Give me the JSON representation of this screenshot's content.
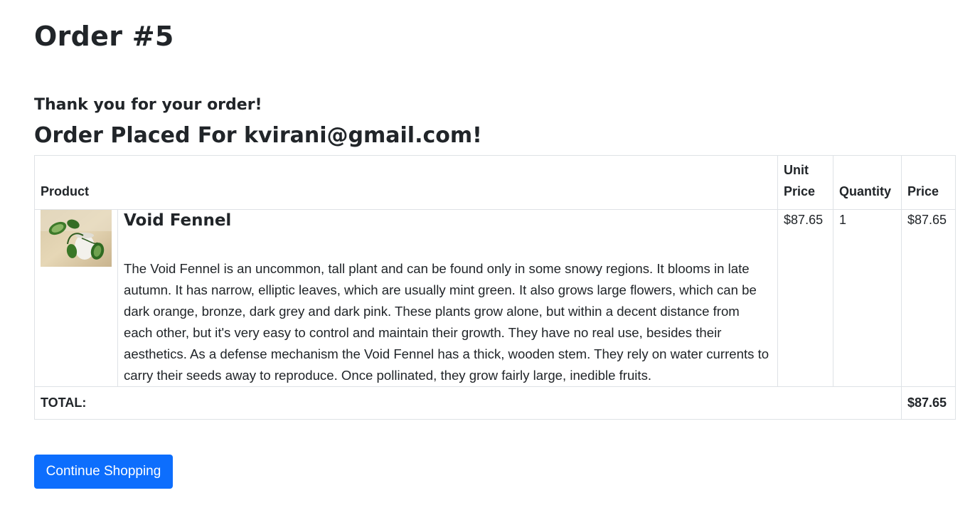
{
  "page": {
    "order_title": "Order #5",
    "thank_you": "Thank you for your order!",
    "placed_for": "Order Placed For kvirani@gmail.com!"
  },
  "table": {
    "headers": {
      "product": "Product",
      "unit_price": "Unit Price",
      "quantity": "Quantity",
      "price": "Price"
    },
    "items": [
      {
        "name": "Void Fennel",
        "description": "The Void Fennel is an uncommon, tall plant and can be found only in some snowy regions. It blooms in late autumn. It has narrow, elliptic leaves, which are usually mint green. It also grows large flowers, which can be dark orange, bronze, dark grey and dark pink. These plants grow alone, but within a decent distance from each other, but it's very easy to control and maintain their growth. They have no real use, besides their aesthetics. As a defense mechanism the Void Fennel has a thick, wooden stem. They rely on water currents to carry their seeds away to reproduce. Once pollinated, they grow fairly large, inedible fruits.",
        "unit_price": "$87.65",
        "quantity": "1",
        "price": "$87.65",
        "image_icon": "plant-photo"
      }
    ],
    "total_label": "TOTAL:",
    "total_value": "$87.65"
  },
  "actions": {
    "continue_label": "Continue Shopping"
  },
  "colors": {
    "primary": "#0d6efd",
    "text": "#212529",
    "border": "#dee2e6"
  }
}
